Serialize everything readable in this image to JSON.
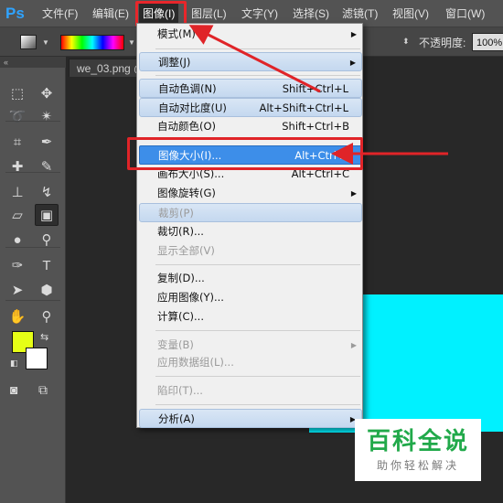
{
  "menubar": {
    "logo": "Ps",
    "items": [
      {
        "label": "文件(F)"
      },
      {
        "label": "编辑(E)"
      },
      {
        "label": "图像(I)"
      },
      {
        "label": "图层(L)"
      },
      {
        "label": "文字(Y)"
      },
      {
        "label": "选择(S)"
      },
      {
        "label": "滤镜(T)"
      },
      {
        "label": "视图(V)"
      },
      {
        "label": "窗口(W)"
      }
    ],
    "active_item": "图像(I)"
  },
  "options_bar": {
    "opacity_label": "不透明度:",
    "opacity_value": "100%"
  },
  "document": {
    "tab_label": "we_03.png @"
  },
  "colors": {
    "foreground": "#e6ff16",
    "background": "#ffffff",
    "canvas_fill": "#00f1ff",
    "highlight": "#e02428",
    "menu_selected": "#3d8ee9"
  },
  "image_menu": {
    "items": [
      {
        "label": "模式(M)",
        "shortcut": "",
        "submenu": true,
        "state": "normal"
      },
      {
        "label": "调整(J)",
        "shortcut": "",
        "submenu": true,
        "state": "hover"
      },
      {
        "label": "自动色调(N)",
        "shortcut": "Shift+Ctrl+L",
        "submenu": false,
        "state": "hover"
      },
      {
        "label": "自动对比度(U)",
        "shortcut": "Alt+Shift+Ctrl+L",
        "submenu": false,
        "state": "hover"
      },
      {
        "label": "自动颜色(O)",
        "shortcut": "Shift+Ctrl+B",
        "submenu": false,
        "state": "normal"
      },
      {
        "label": "图像大小(I)...",
        "shortcut": "Alt+Ctrl+I",
        "submenu": false,
        "state": "selected"
      },
      {
        "label": "画布大小(S)...",
        "shortcut": "Alt+Ctrl+C",
        "submenu": false,
        "state": "normal"
      },
      {
        "label": "图像旋转(G)",
        "shortcut": "",
        "submenu": true,
        "state": "normal"
      },
      {
        "label": "裁剪(P)",
        "shortcut": "",
        "submenu": false,
        "state": "disabled-hover"
      },
      {
        "label": "裁切(R)...",
        "shortcut": "",
        "submenu": false,
        "state": "normal"
      },
      {
        "label": "显示全部(V)",
        "shortcut": "",
        "submenu": false,
        "state": "disabled"
      },
      {
        "label": "复制(D)...",
        "shortcut": "",
        "submenu": false,
        "state": "normal"
      },
      {
        "label": "应用图像(Y)...",
        "shortcut": "",
        "submenu": false,
        "state": "normal"
      },
      {
        "label": "计算(C)...",
        "shortcut": "",
        "submenu": false,
        "state": "normal"
      },
      {
        "label": "变量(B)",
        "shortcut": "",
        "submenu": true,
        "state": "disabled"
      },
      {
        "label": "应用数据组(L)...",
        "shortcut": "",
        "submenu": false,
        "state": "disabled"
      },
      {
        "label": "陷印(T)...",
        "shortcut": "",
        "submenu": false,
        "state": "disabled"
      },
      {
        "label": "分析(A)",
        "shortcut": "",
        "submenu": true,
        "state": "hover"
      }
    ]
  },
  "tools": [
    {
      "icon": "marquee-icon",
      "glyph": "⬚"
    },
    {
      "icon": "move-icon",
      "glyph": "✥"
    },
    {
      "icon": "lasso-icon",
      "glyph": "➰"
    },
    {
      "icon": "magic-wand-icon",
      "glyph": "✴"
    },
    {
      "icon": "crop-icon",
      "glyph": "⌗"
    },
    {
      "icon": "eyedropper-icon",
      "glyph": "✒"
    },
    {
      "icon": "healing-brush-icon",
      "glyph": "✚"
    },
    {
      "icon": "brush-icon",
      "glyph": "✎"
    },
    {
      "icon": "clone-stamp-icon",
      "glyph": "⊥"
    },
    {
      "icon": "history-brush-icon",
      "glyph": "↯"
    },
    {
      "icon": "eraser-icon",
      "glyph": "▱"
    },
    {
      "icon": "gradient-icon",
      "glyph": "▣"
    },
    {
      "icon": "blur-icon",
      "glyph": "●"
    },
    {
      "icon": "dodge-icon",
      "glyph": "⚲"
    },
    {
      "icon": "pen-icon",
      "glyph": "✑"
    },
    {
      "icon": "type-icon",
      "glyph": "T"
    },
    {
      "icon": "path-selection-icon",
      "glyph": "➤"
    },
    {
      "icon": "shape-icon",
      "glyph": "⬢"
    },
    {
      "icon": "hand-icon",
      "glyph": "✋"
    },
    {
      "icon": "zoom-icon",
      "glyph": "⚲"
    }
  ],
  "watermark": {
    "main": "百科全说",
    "sub": "助你轻松解决"
  }
}
